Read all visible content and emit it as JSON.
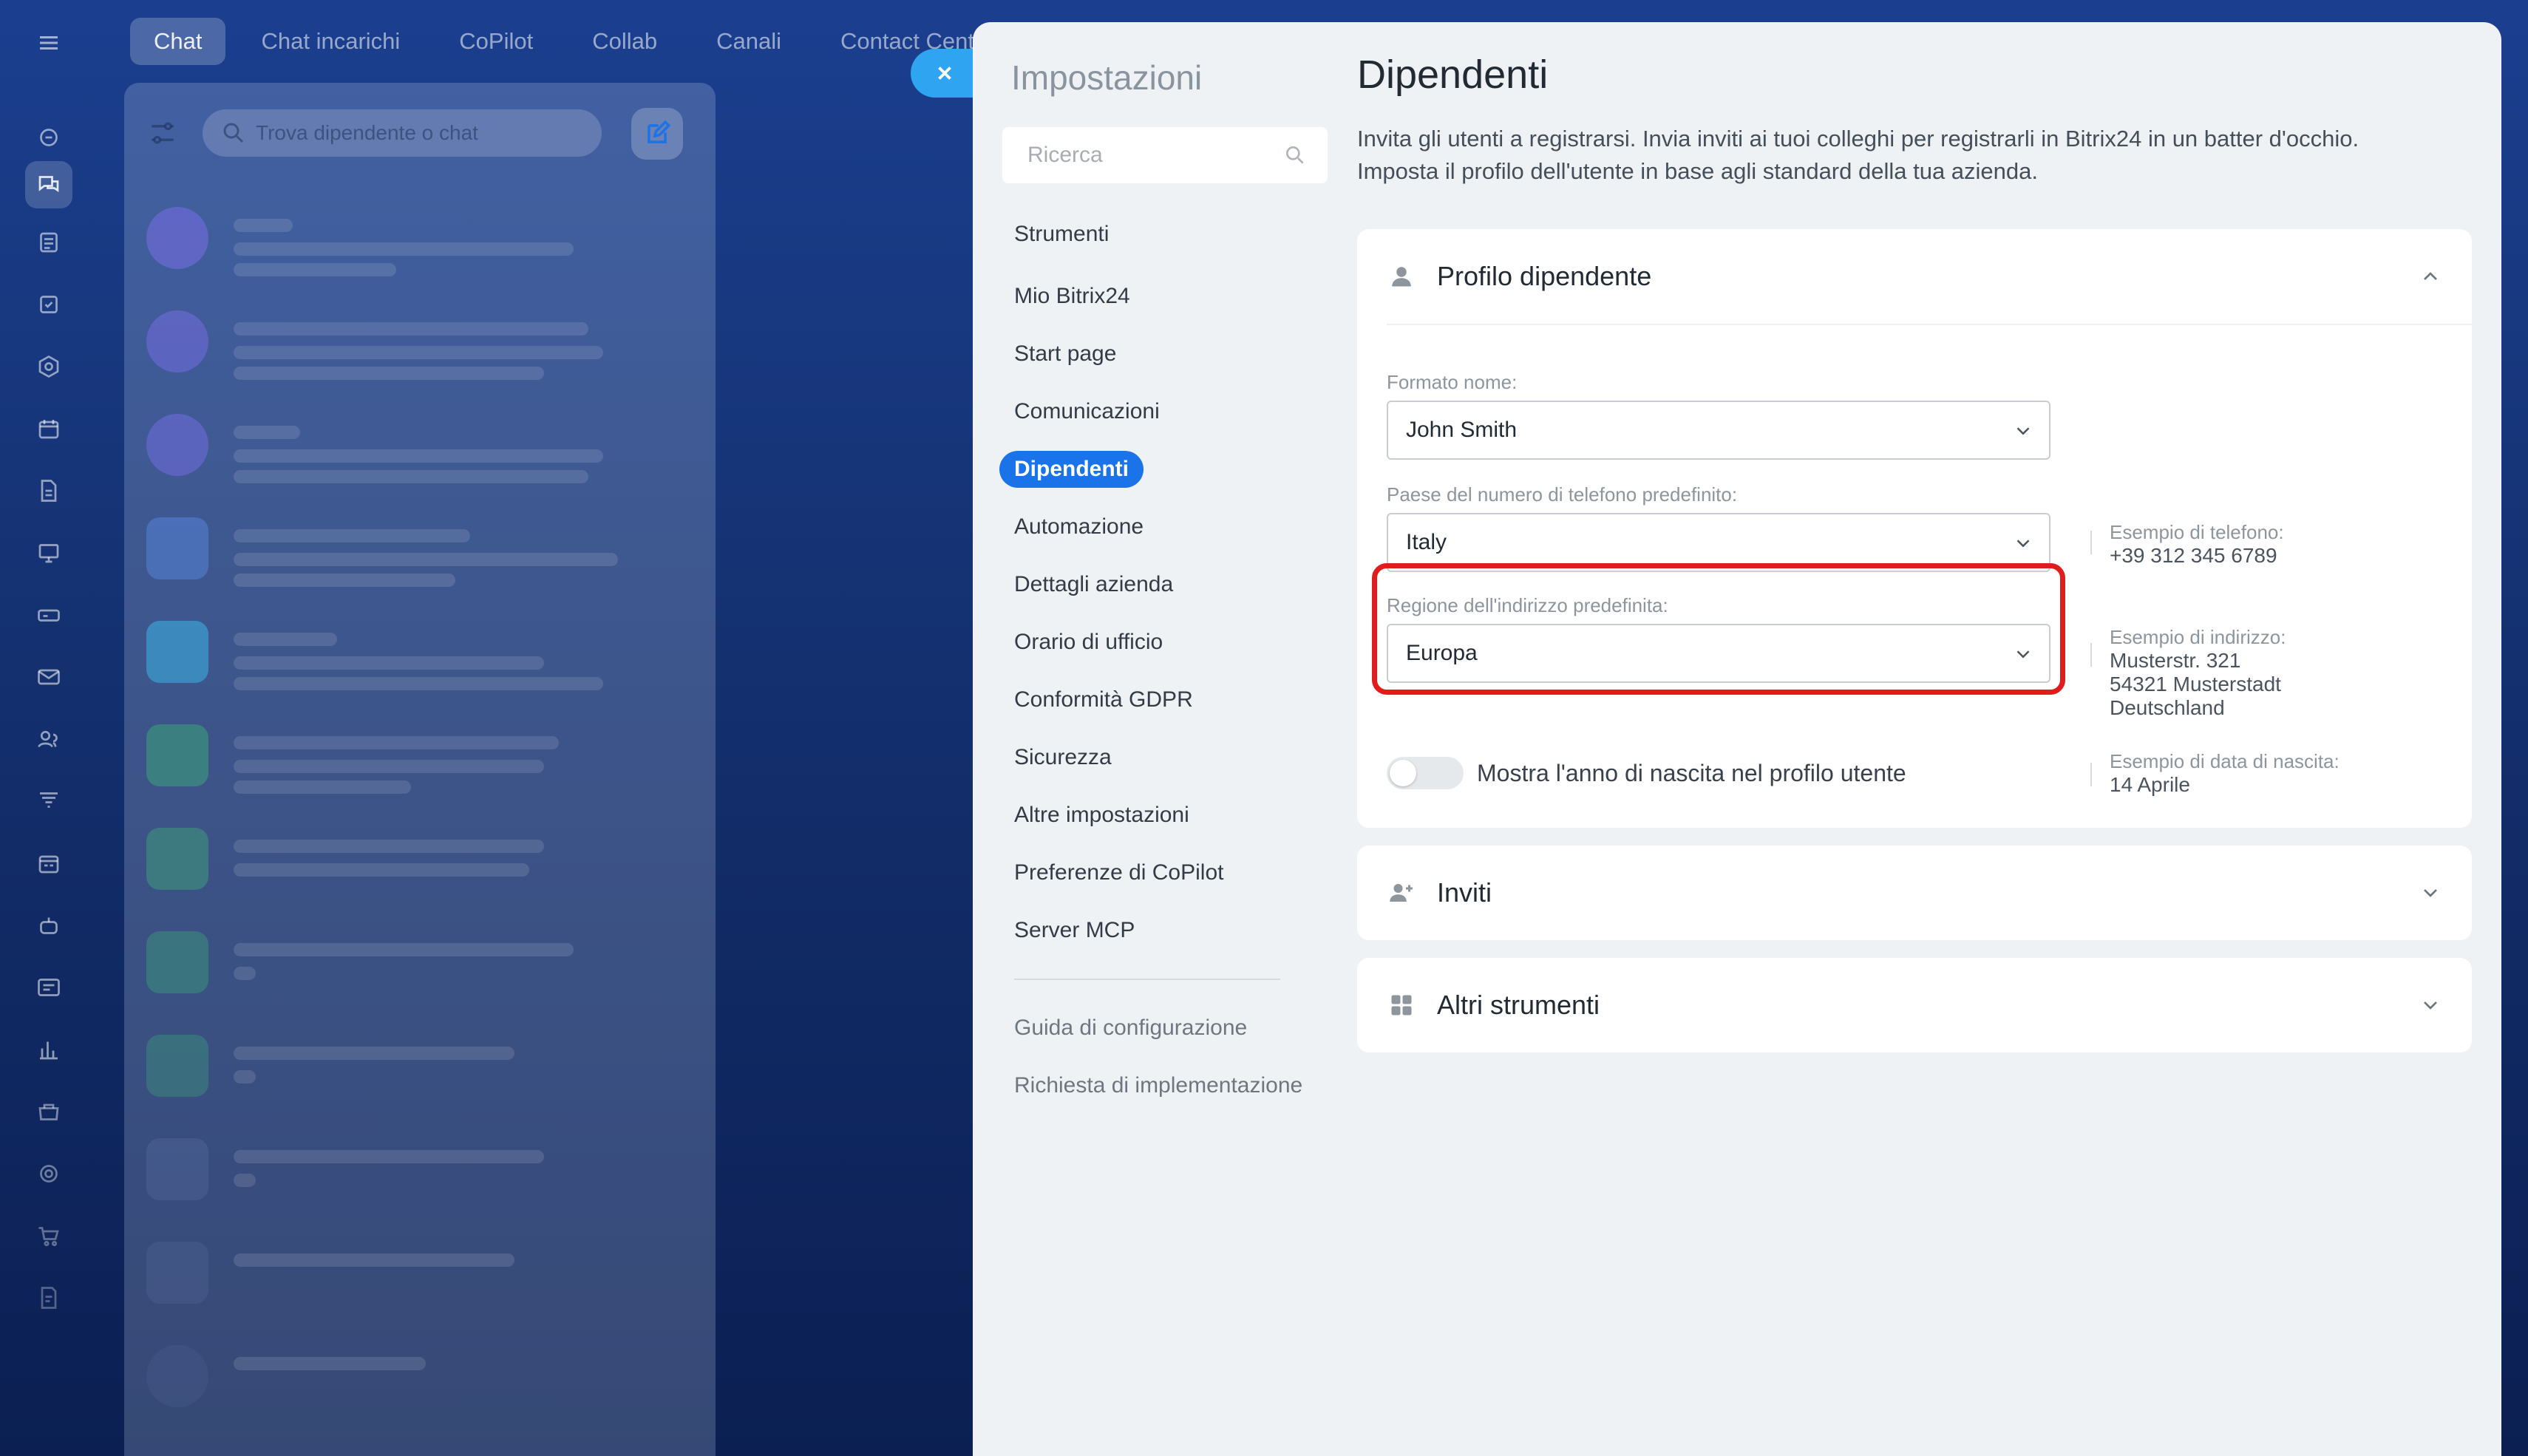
{
  "top_tabs": [
    "Chat",
    "Chat incarichi",
    "CoPilot",
    "Collab",
    "Canali",
    "Contact Center"
  ],
  "chat_search_placeholder": "Trova dipendente o chat",
  "sidebar": {
    "title": "Impostazioni",
    "search_placeholder": "Ricerca",
    "items": [
      {
        "label": "Strumenti"
      },
      {
        "label": "Mio Bitrix24"
      },
      {
        "label": "Start page"
      },
      {
        "label": "Comunicazioni"
      },
      {
        "label": "Dipendenti",
        "active": true
      },
      {
        "label": "Automazione"
      },
      {
        "label": "Dettagli azienda"
      },
      {
        "label": "Orario di ufficio"
      },
      {
        "label": "Conformità GDPR"
      },
      {
        "label": "Sicurezza"
      },
      {
        "label": "Altre impostazioni"
      },
      {
        "label": "Preferenze di CoPilot"
      },
      {
        "label": "Server MCP"
      }
    ],
    "footer_links": [
      "Guida di configurazione",
      "Richiesta di implementazione"
    ]
  },
  "main": {
    "title": "Dipendenti",
    "description_line1": "Invita gli utenti a registrarsi. Invia inviti ai tuoi colleghi per registrarli in Bitrix24 in un batter d'occhio.",
    "description_line2": "Imposta il profilo dell'utente in base agli standard della tua azienda."
  },
  "profile_card": {
    "title": "Profilo dipendente",
    "name_format": {
      "label": "Formato nome:",
      "value": "John Smith"
    },
    "phone_country": {
      "label": "Paese del numero di telefono predefinito:",
      "value": "Italy",
      "example_label": "Esempio di telefono:",
      "example_value": "+39 312 345 6789"
    },
    "address_region": {
      "label": "Regione dell'indirizzo predefinita:",
      "value": "Europa",
      "example_label": "Esempio di indirizzo:",
      "example_line1": "Musterstr. 321",
      "example_line2": "54321 Musterstadt",
      "example_line3": "Deutschland"
    },
    "birth_year": {
      "label": "Mostra l'anno di nascita nel profilo utente",
      "enabled": false,
      "example_label": "Esempio di data di nascita:",
      "example_value": "14 Aprile"
    }
  },
  "invites_card": {
    "title": "Inviti"
  },
  "tools_card": {
    "title": "Altri strumenti"
  },
  "colors": {
    "accent": "#1a73e8",
    "highlight": "#e01c1c",
    "close_button": "#2fa4f0"
  }
}
